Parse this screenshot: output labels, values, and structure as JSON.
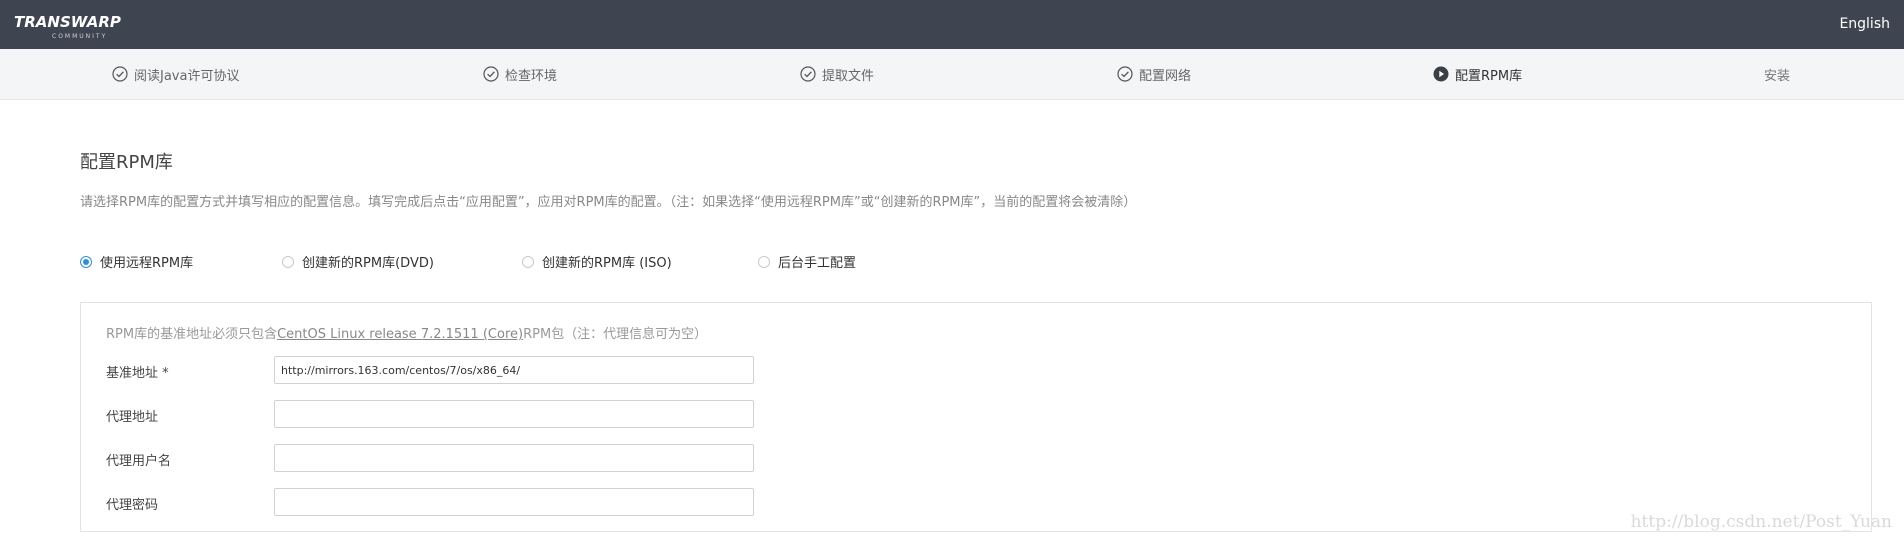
{
  "header": {
    "logo_text": "TRANSWARP",
    "logo_subtext": "COMMUNITY",
    "language": "English"
  },
  "steps": [
    {
      "label": "阅读Java许可协议",
      "state": "done",
      "icon": "check-circle-icon"
    },
    {
      "label": "检查环境",
      "state": "done",
      "icon": "check-circle-icon"
    },
    {
      "label": "提取文件",
      "state": "done",
      "icon": "check-circle-icon"
    },
    {
      "label": "配置网络",
      "state": "done",
      "icon": "check-circle-icon"
    },
    {
      "label": "配置RPM库",
      "state": "active",
      "icon": "play-circle-icon"
    },
    {
      "label": "安装",
      "state": "pending",
      "icon": ""
    }
  ],
  "main": {
    "title": "配置RPM库",
    "description": "请选择RPM库的配置方式并填写相应的配置信息。填写完成后点击“应用配置”，应用对RPM库的配置。（注：如果选择“使用远程RPM库”或“创建新的RPM库”，当前的配置将会被清除）"
  },
  "options": [
    {
      "label": "使用远程RPM库",
      "checked": true
    },
    {
      "label": "创建新的RPM库(DVD)",
      "checked": false
    },
    {
      "label": "创建新的RPM库 (ISO)",
      "checked": false
    },
    {
      "label": "后台手工配置",
      "checked": false
    }
  ],
  "form": {
    "note_prefix": "RPM库的基准地址必须只包含",
    "note_link": "CentOS Linux release 7.2.1511 (Core)",
    "note_suffix": "RPM包（注：代理信息可为空）",
    "fields": [
      {
        "label": "基准地址 *",
        "value": "http://mirrors.163.com/centos/7/os/x86_64/",
        "placeholder": ""
      },
      {
        "label": "代理地址",
        "value": "",
        "placeholder": ""
      },
      {
        "label": "代理用户名",
        "value": "",
        "placeholder": ""
      },
      {
        "label": "代理密码",
        "value": "",
        "placeholder": ""
      }
    ]
  },
  "watermark": "http://blog.csdn.net/Post_Yuan",
  "colors": {
    "topbar": "#3f4550",
    "accent": "#2f8ed8",
    "steps_bg": "#f4f5f6"
  }
}
